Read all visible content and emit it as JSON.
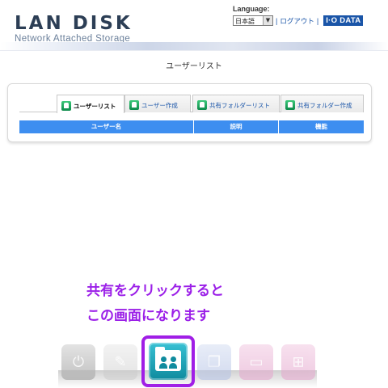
{
  "header": {
    "logo_title": "LAN DISK",
    "logo_subtitle": "Network Attached Storage",
    "language_label": "Language:",
    "language_value": "日本語",
    "logout": "ログアウト",
    "brand": "I·O DATA"
  },
  "page": {
    "title": "ユーザーリスト"
  },
  "tabs": [
    {
      "label": "ユーザーリスト",
      "active": true
    },
    {
      "label": "ユーザー作成",
      "active": false
    },
    {
      "label": "共有フォルダーリスト",
      "active": false
    },
    {
      "label": "共有フォルダー作成",
      "active": false
    }
  ],
  "table": {
    "columns": [
      "ユーザー名",
      "説明",
      "機能"
    ]
  },
  "annotation": {
    "line1": "共有をクリックすると",
    "line2": "この画面になります"
  },
  "dock": {
    "items": [
      {
        "name": "power-icon",
        "color": "#b9b9b9"
      },
      {
        "name": "tools-icon",
        "color": "#c8c8c8"
      },
      {
        "name": "share-icon",
        "color": "#17a7b8"
      },
      {
        "name": "copy-icon",
        "color": "#b8c6e6"
      },
      {
        "name": "disk-icon",
        "color": "#e6a9cf"
      },
      {
        "name": "network-icon",
        "color": "#e6a9cf"
      }
    ]
  },
  "colors": {
    "accent_blue": "#3d8ef0",
    "annotation_purple": "#9b1fe8",
    "link_blue": "#1a55a8"
  }
}
